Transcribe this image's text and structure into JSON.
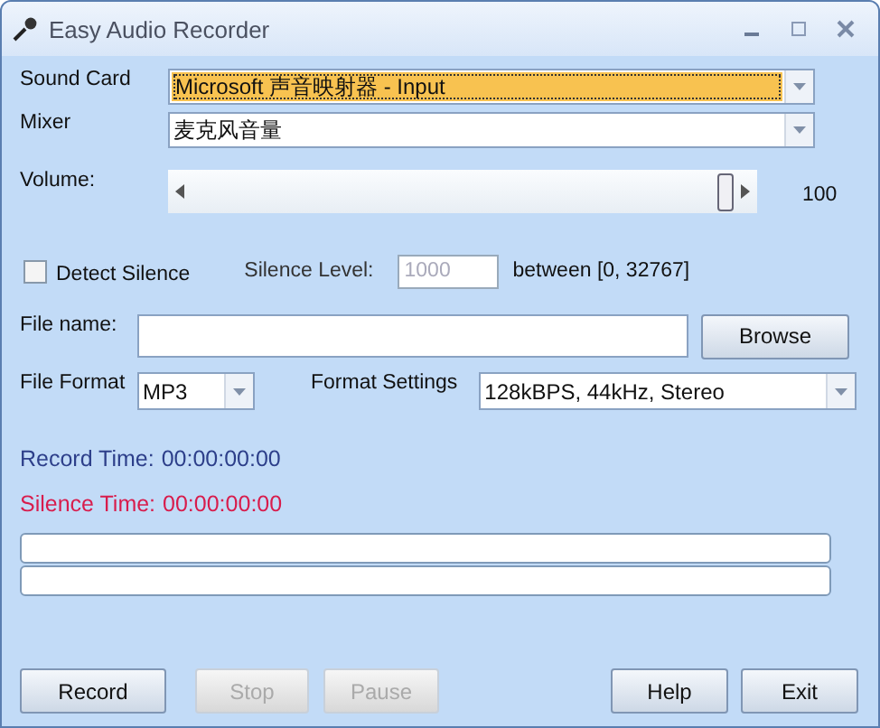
{
  "window": {
    "title": "Easy Audio Recorder"
  },
  "sound_card": {
    "label": "Sound Card",
    "value": "Microsoft 声音映射器 - Input",
    "focused": true
  },
  "mixer": {
    "label": "Mixer",
    "value": "麦克风音量",
    "focused": false
  },
  "volume": {
    "label": "Volume:",
    "level": 1,
    "reading": "100"
  },
  "detect_silence": {
    "label": "Detect Silence",
    "checked": false
  },
  "silence_level": {
    "label": "Silence Level:",
    "value": "1000",
    "disabled": true,
    "range": "between [0, 32767]"
  },
  "file_name": {
    "label": "File name:",
    "button": "Browse"
  },
  "file_format": {
    "label": "File Format",
    "value": "MP3"
  },
  "format_settings": {
    "label": "Format Settings",
    "value": "128kBPS, 44kHz, Stereo"
  },
  "times": [
    {
      "kind": "record",
      "label": "Record Time:",
      "value": "00:00:00:00"
    },
    {
      "kind": "silence",
      "label": "Silence Time:",
      "value": "00:00:00:00"
    }
  ],
  "progress_bars": [
    {
      "level": 0
    },
    {
      "level": 0
    }
  ],
  "buttons": [
    {
      "label": "Record",
      "disabled": false
    },
    {
      "label": "Stop",
      "disabled": true
    },
    {
      "label": "Pause",
      "disabled": true
    },
    {
      "label": "Help",
      "disabled": false
    },
    {
      "label": "Exit",
      "disabled": false
    }
  ]
}
